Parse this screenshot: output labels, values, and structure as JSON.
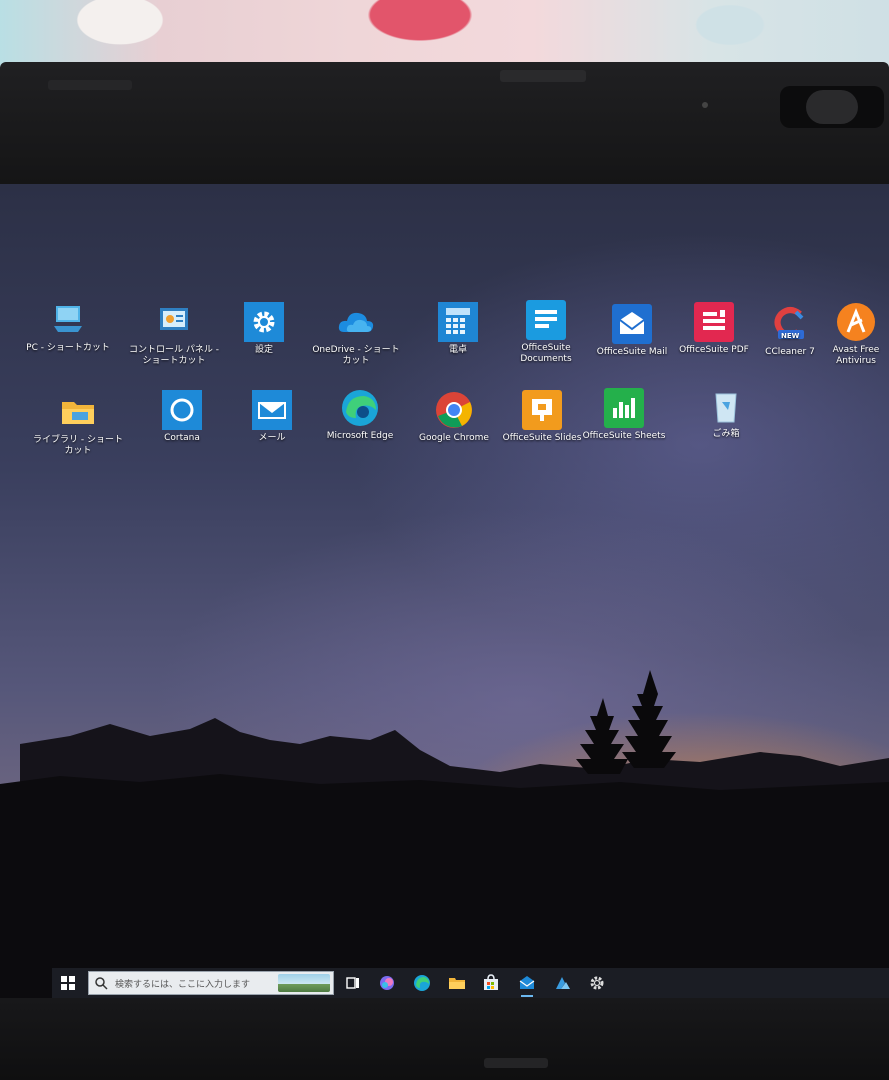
{
  "desktop": {
    "row1": [
      {
        "label": "PC - ショートカット",
        "icon": "pc-icon"
      },
      {
        "label": "コントロール パネル - ショートカット",
        "icon": "control-panel-icon"
      },
      {
        "label": "設定",
        "icon": "settings-gear-icon"
      },
      {
        "label": "OneDrive - ショートカット",
        "icon": "onedrive-cloud-icon"
      },
      {
        "label": "電卓",
        "icon": "calculator-icon"
      },
      {
        "label": "OfficeSuite Documents",
        "icon": "officesuite-documents-icon"
      },
      {
        "label": "OfficeSuite Mail",
        "icon": "officesuite-mail-icon"
      },
      {
        "label": "OfficeSuite PDF",
        "icon": "officesuite-pdf-icon"
      },
      {
        "label": "CCleaner 7",
        "icon": "ccleaner-icon"
      },
      {
        "label": "Avast Free Antivirus",
        "icon": "avast-icon"
      }
    ],
    "row2": [
      {
        "label": "ライブラリ - ショートカット",
        "icon": "library-folder-icon"
      },
      {
        "label": "Cortana",
        "icon": "cortana-icon"
      },
      {
        "label": "メール",
        "icon": "mail-icon"
      },
      {
        "label": "Microsoft Edge",
        "icon": "edge-icon"
      },
      {
        "label": "Google Chrome",
        "icon": "chrome-icon"
      },
      {
        "label": "OfficeSuite Slides",
        "icon": "officesuite-slides-icon"
      },
      {
        "label": "OfficeSuite Sheets",
        "icon": "officesuite-sheets-icon"
      },
      {
        "label": "ごみ箱",
        "icon": "recycle-bin-icon"
      }
    ],
    "ccleaner_badge": "NEW"
  },
  "taskbar": {
    "search_placeholder": "検索するには、ここに入力します",
    "pinned": [
      "task-view-icon",
      "copilot-icon",
      "edge-icon",
      "file-explorer-icon",
      "store-icon",
      "mail-icon",
      "azure-icon",
      "settings-icon"
    ]
  },
  "colors": {
    "taskbar": "#1b1d24",
    "desktop_text": "#ffffff",
    "windows_blue": "#1e8ad8"
  }
}
